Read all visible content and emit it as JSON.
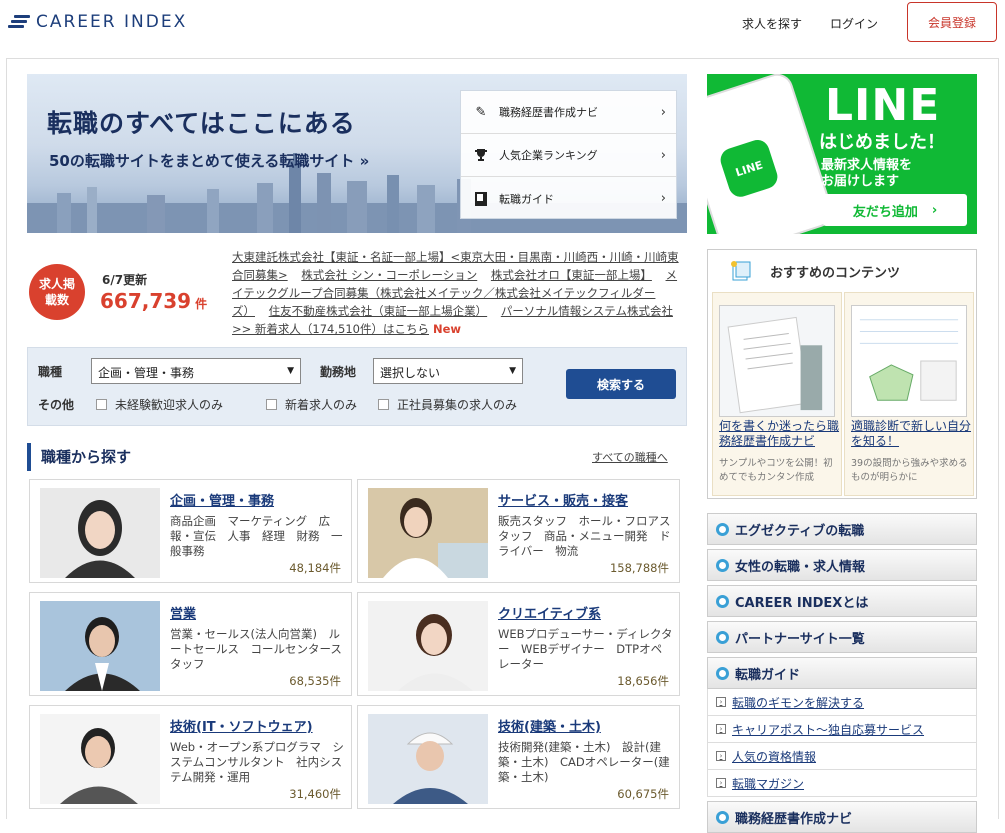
{
  "header": {
    "logo_text": "CAREER INDEX",
    "nav_find": "求人を探す",
    "nav_login": "ログイン",
    "register": "会員登録"
  },
  "hero": {
    "title": "転職のすべてはここにある",
    "subtitle": "50の転職サイトをまとめて使える転職サイト »",
    "menu": [
      {
        "label": "職務経歴書作成ナビ",
        "icon": "pencil-icon"
      },
      {
        "label": "人気企業ランキング",
        "icon": "trophy-icon"
      },
      {
        "label": "転職ガイド",
        "icon": "book-icon"
      }
    ]
  },
  "stats": {
    "badge": "求人掲載数",
    "updated": "6/7更新",
    "count": "667,739",
    "unit": "件"
  },
  "companies": [
    "大東建託株式会社【東証・名証一部上場】<東京大田・目黒南・川崎西・川崎・川崎東合同募集>",
    "株式会社 シン・コーポレーション",
    "株式会社オロ【東証一部上場】",
    "メイテックグループ合同募集（株式会社メイテック／株式会社メイテックフィルダーズ）",
    "住友不動産株式会社（東証一部上場企業）",
    "パーソナル情報システム株式会社",
    ">> 新着求人（174,510件）はこちら"
  ],
  "companies_new": "New",
  "search": {
    "job_label": "職種",
    "job_value": "企画・管理・事務",
    "location_label": "勤務地",
    "location_value": "選択しない",
    "other_label": "その他",
    "checks": [
      "未経験歓迎求人のみ",
      "新着求人のみ",
      "正社員募集の求人のみ"
    ],
    "submit": "検索する"
  },
  "jobs_section": {
    "title": "職種から探す",
    "all_link": "すべての職種へ",
    "cards": [
      {
        "title": "企画・管理・事務",
        "desc": "商品企画　マーケティング　広報・宣伝　人事　経理　財務　一般事務",
        "count": "48,184件"
      },
      {
        "title": "サービス・販売・接客",
        "desc": "販売スタッフ　ホール・フロアスタッフ　商品・メニュー開発　ドライバー　物流",
        "count": "158,788件"
      },
      {
        "title": "営業",
        "desc": "営業・セールス(法人向営業)　ルートセールス　コールセンタースタッフ",
        "count": "68,535件"
      },
      {
        "title": "クリエイティブ系",
        "desc": "WEBプロデューサー・ディレクター　WEBデザイナー　DTPオペレーター",
        "count": "18,656件"
      },
      {
        "title": "技術(IT・ソフトウェア)",
        "desc": "Web・オープン系プログラマ　システムコンサルタント　社内システム開発・運用",
        "count": "31,460件"
      },
      {
        "title": "技術(建築・土木)",
        "desc": "技術開発(建築・土木)　設計(建築・土木)　CADオペレーター(建築・土木)",
        "count": "60,675件"
      }
    ]
  },
  "line_ad": {
    "big": "LINE",
    "headline": "はじめました！",
    "sub1": "最新求人情報を",
    "sub2": "お届けします",
    "button": "友だち追加",
    "phone_logo": "LINE"
  },
  "recommend": {
    "title": "おすすめのコンテンツ",
    "items": [
      {
        "title": "何を書くか迷ったら職務経歴書作成ナビ",
        "desc": "サンプルやコツを公開！初めてでもカンタン作成"
      },
      {
        "title": "適職診断で新しい自分を知る！",
        "desc": "39の設問から強みや求めるものが明らかに"
      }
    ]
  },
  "side_menu": {
    "items": [
      "エグゼクティブの転職",
      "女性の転職・求人情報",
      "CAREER INDEXとは",
      "パートナーサイト一覧",
      "転職ガイド"
    ],
    "guide_sub": [
      "転職のギモンを解決する",
      "キャリアポスト〜独自応募サービス",
      "人気の資格情報",
      "転職マガジン"
    ],
    "last": "職務経歴書作成ナビ"
  }
}
